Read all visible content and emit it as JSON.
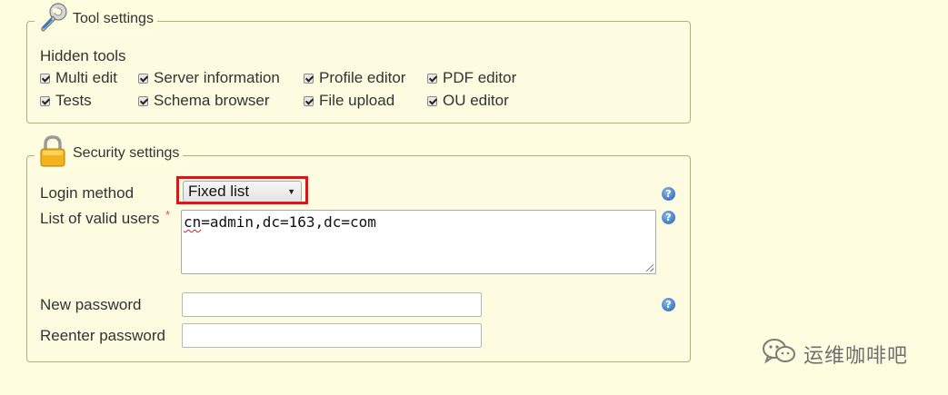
{
  "tool_settings": {
    "legend": "Tool settings",
    "legend_icon": "wrench-icon",
    "hidden_tools_label": "Hidden tools",
    "tools": [
      {
        "label": "Multi edit",
        "checked": true
      },
      {
        "label": "Server information",
        "checked": true
      },
      {
        "label": "Profile editor",
        "checked": true
      },
      {
        "label": "PDF editor",
        "checked": true
      },
      {
        "label": "Tests",
        "checked": true
      },
      {
        "label": "Schema browser",
        "checked": true
      },
      {
        "label": "File upload",
        "checked": true
      },
      {
        "label": "OU editor",
        "checked": true
      }
    ]
  },
  "security_settings": {
    "legend": "Security settings",
    "legend_icon": "padlock-icon",
    "login_method_label": "Login method",
    "login_method_value": "Fixed list",
    "valid_users_label": "List of valid users",
    "required_marker": "*",
    "valid_users_value_err": "cn",
    "valid_users_value_rest": "=admin,dc=163,dc=com",
    "new_password_label": "New password",
    "reenter_password_label": "Reenter password",
    "help_icon": "help-icon",
    "help_glyph": "?",
    "highlight_color": "#e4101a"
  },
  "watermark": {
    "icon": "wechat-icon",
    "text": "运维咖啡吧"
  }
}
